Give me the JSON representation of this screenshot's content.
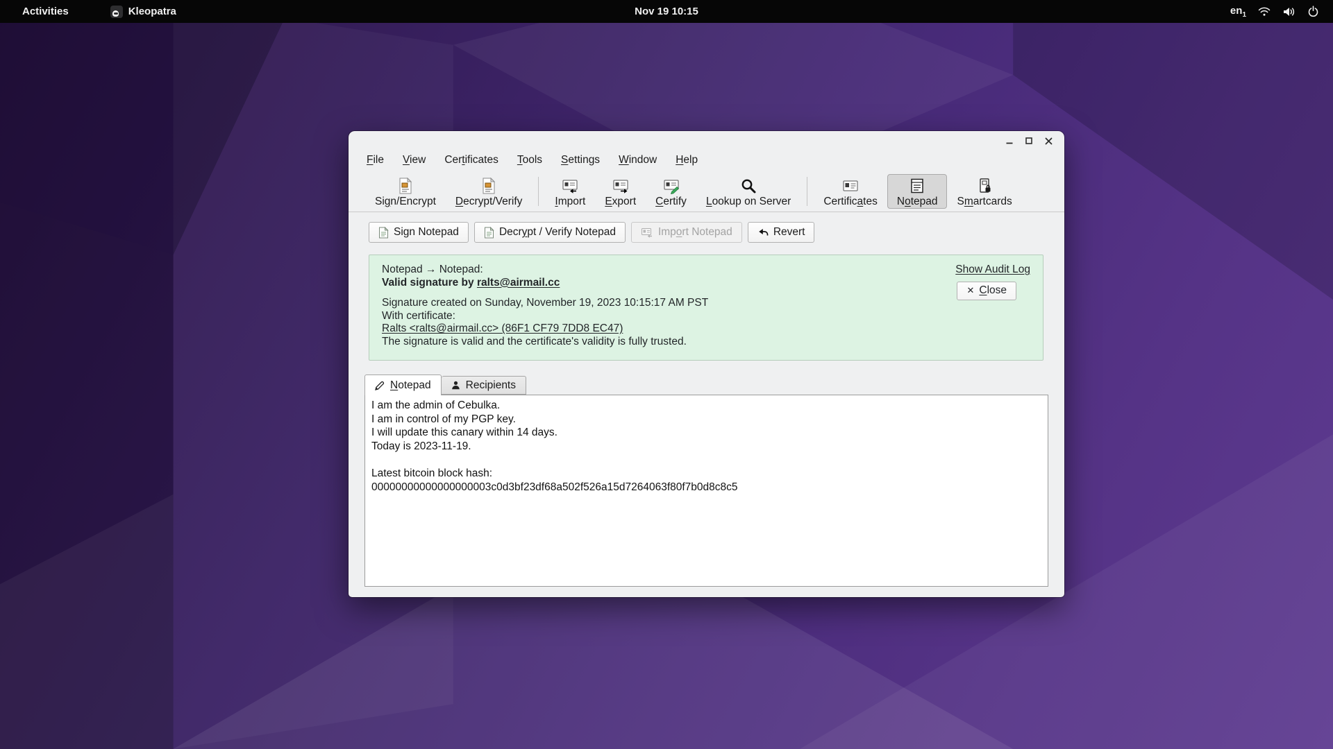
{
  "topbar": {
    "activities_label": "Activities",
    "app_name": "Kleopatra",
    "clock": "Nov 19 10:15",
    "input_source": "en",
    "input_source_index": "1"
  },
  "colors": {
    "topbar_bg": "#060606",
    "window_bg": "#eff0f1",
    "banner_bg": "#ddf3e3",
    "banner_border": "#b6cdbb",
    "selected_tool_bg": "#d7d7d7",
    "wallpaper_dark": "#2b1545",
    "wallpaper_light": "#5e3b91"
  },
  "icons": {
    "revert_glyph": "back-curved-arrow",
    "close_glyph": "✕"
  },
  "window": {
    "menu": [
      {
        "pre": "",
        "u": "F",
        "post": "ile"
      },
      {
        "pre": "",
        "u": "V",
        "post": "iew"
      },
      {
        "pre": "Cer",
        "u": "t",
        "post": "ificates"
      },
      {
        "pre": "",
        "u": "T",
        "post": "ools"
      },
      {
        "pre": "",
        "u": "S",
        "post": "ettings"
      },
      {
        "pre": "",
        "u": "W",
        "post": "indow"
      },
      {
        "pre": "",
        "u": "H",
        "post": "elp"
      }
    ],
    "toolbar": [
      {
        "pre": "Si",
        "u": "g",
        "post": "n/Encrypt"
      },
      {
        "pre": "",
        "u": "D",
        "post": "ecrypt/Verify"
      },
      {
        "pre": "",
        "u": "I",
        "post": "mport"
      },
      {
        "pre": "",
        "u": "E",
        "post": "xport"
      },
      {
        "pre": "",
        "u": "C",
        "post": "ertify"
      },
      {
        "pre": "",
        "u": "L",
        "post": "ookup on Server"
      },
      {
        "pre": "Certific",
        "u": "a",
        "post": "tes"
      },
      {
        "pre": "N",
        "u": "o",
        "post": "tepad"
      },
      {
        "pre": "S",
        "u": "m",
        "post": "artcards"
      }
    ],
    "actions": {
      "sign": {
        "pre": "Sign Notepad",
        "u": "",
        "post": ""
      },
      "decrypt": {
        "pre": "Decr",
        "u": "y",
        "post": "pt / Verify Notepad"
      },
      "import": {
        "pre": "Imp",
        "u": "o",
        "post": "rt Notepad"
      },
      "revert": {
        "pre": "Revert",
        "u": "",
        "post": ""
      }
    },
    "banner": {
      "operation": "Notepad → Notepad:",
      "status_prefix": "Valid signature by ",
      "signer_link": "ralts@airmail.cc",
      "created": "Signature created on Sunday, November 19, 2023 10:15:17 AM PST",
      "with_certificate": "With certificate:",
      "certificate_link": "Ralts <ralts@airmail.cc> (86F1 CF79 7DD8 EC47)",
      "validity": "The signature is valid and the certificate's validity is fully trusted.",
      "audit_link": "Show Audit Log",
      "close_glyph": "✕",
      "close": {
        "pre": "",
        "u": "C",
        "post": "lose"
      }
    },
    "tabs": [
      {
        "pre": "",
        "u": "N",
        "post": "otepad"
      },
      {
        "pre": "Recipients",
        "u": "",
        "post": ""
      }
    ],
    "editor": {
      "text": "I am the admin of Cebulka.\nI am in control of my PGP key.\nI will update this canary within 14 days.\nToday is 2023-11-19.\n\nLatest bitcoin block hash:\n00000000000000000003c0d3bf23df68a502f526a15d7264063f80f7b0d8c8c5"
    }
  }
}
